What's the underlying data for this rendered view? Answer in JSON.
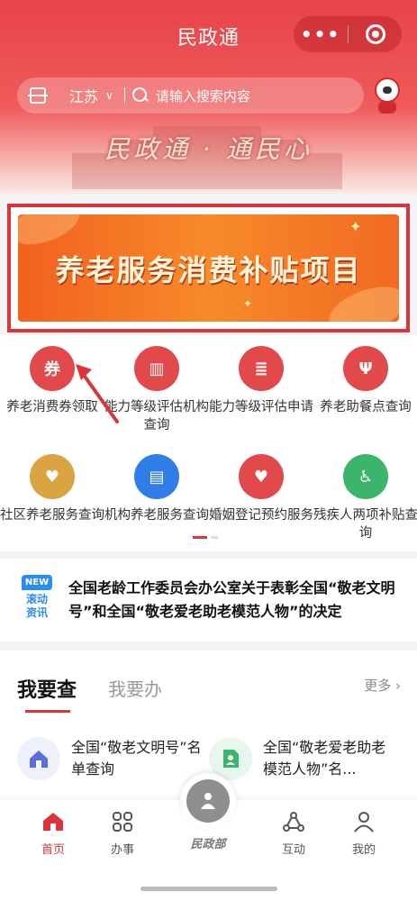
{
  "header": {
    "title": "民政通",
    "more_icon": "more-dots-icon",
    "close_icon": "target-close-icon",
    "background_color": "#e8434a"
  },
  "search": {
    "region": "江苏",
    "placeholder": "请输入搜索内容"
  },
  "slogan": "民政通 · 通民心",
  "banner": {
    "title": "养老服务消费补贴项目",
    "highlight_border_color": "#d9363b"
  },
  "services": [
    {
      "label": "养老消费券领取",
      "icon": "voucher-icon",
      "color": "#e2494b",
      "glyph": "券"
    },
    {
      "label": "能力等级评估机构查询",
      "icon": "building-icon",
      "color": "#e2494b",
      "glyph": "▥"
    },
    {
      "label": "能力等级评估申请",
      "icon": "form-icon",
      "color": "#e2494b",
      "glyph": "≣"
    },
    {
      "label": "养老助餐点查询",
      "icon": "fork-knife-icon",
      "color": "#e2494b",
      "glyph": "Ψ"
    },
    {
      "label": "社区养老服务查询",
      "icon": "home-heart-icon",
      "color": "#d9a441",
      "glyph": "♥"
    },
    {
      "label": "机构养老服务查询",
      "icon": "document-icon",
      "color": "#2f7de6",
      "glyph": "▤"
    },
    {
      "label": "婚姻登记预约服务",
      "icon": "couple-icon",
      "color": "#e2494b",
      "glyph": "♥"
    },
    {
      "label": "残疾人两项补贴查询",
      "icon": "wheelchair-icon",
      "color": "#3bb56b",
      "glyph": "♿"
    }
  ],
  "news": {
    "badge_new": "NEW",
    "badge_label": "滚动资讯",
    "text": "全国老龄工作委员会办公室关于表彰全国“敬老文明号”和全国“敬老爱老助老模范人物”的决定"
  },
  "query": {
    "tab_active": "我要查",
    "tab_other": "我要办",
    "more": "更多 ›",
    "items": [
      {
        "label": "全国“敬老文明号”名单查询",
        "icon": "home-icon",
        "color": "#5a6fd8"
      },
      {
        "label": "全国“敬老爱老助老模范人物”名...",
        "icon": "person-doc-icon",
        "color": "#3bb56b"
      }
    ]
  },
  "tabbar": {
    "items": [
      {
        "label": "首页",
        "icon": "home-icon",
        "active": true
      },
      {
        "label": "办事",
        "icon": "grid-icon"
      },
      {
        "label": "民政部",
        "icon": "ministry-logo-icon"
      },
      {
        "label": "互动",
        "icon": "share-icon"
      },
      {
        "label": "我的",
        "icon": "user-icon"
      }
    ],
    "active_color": "#d9363b"
  }
}
